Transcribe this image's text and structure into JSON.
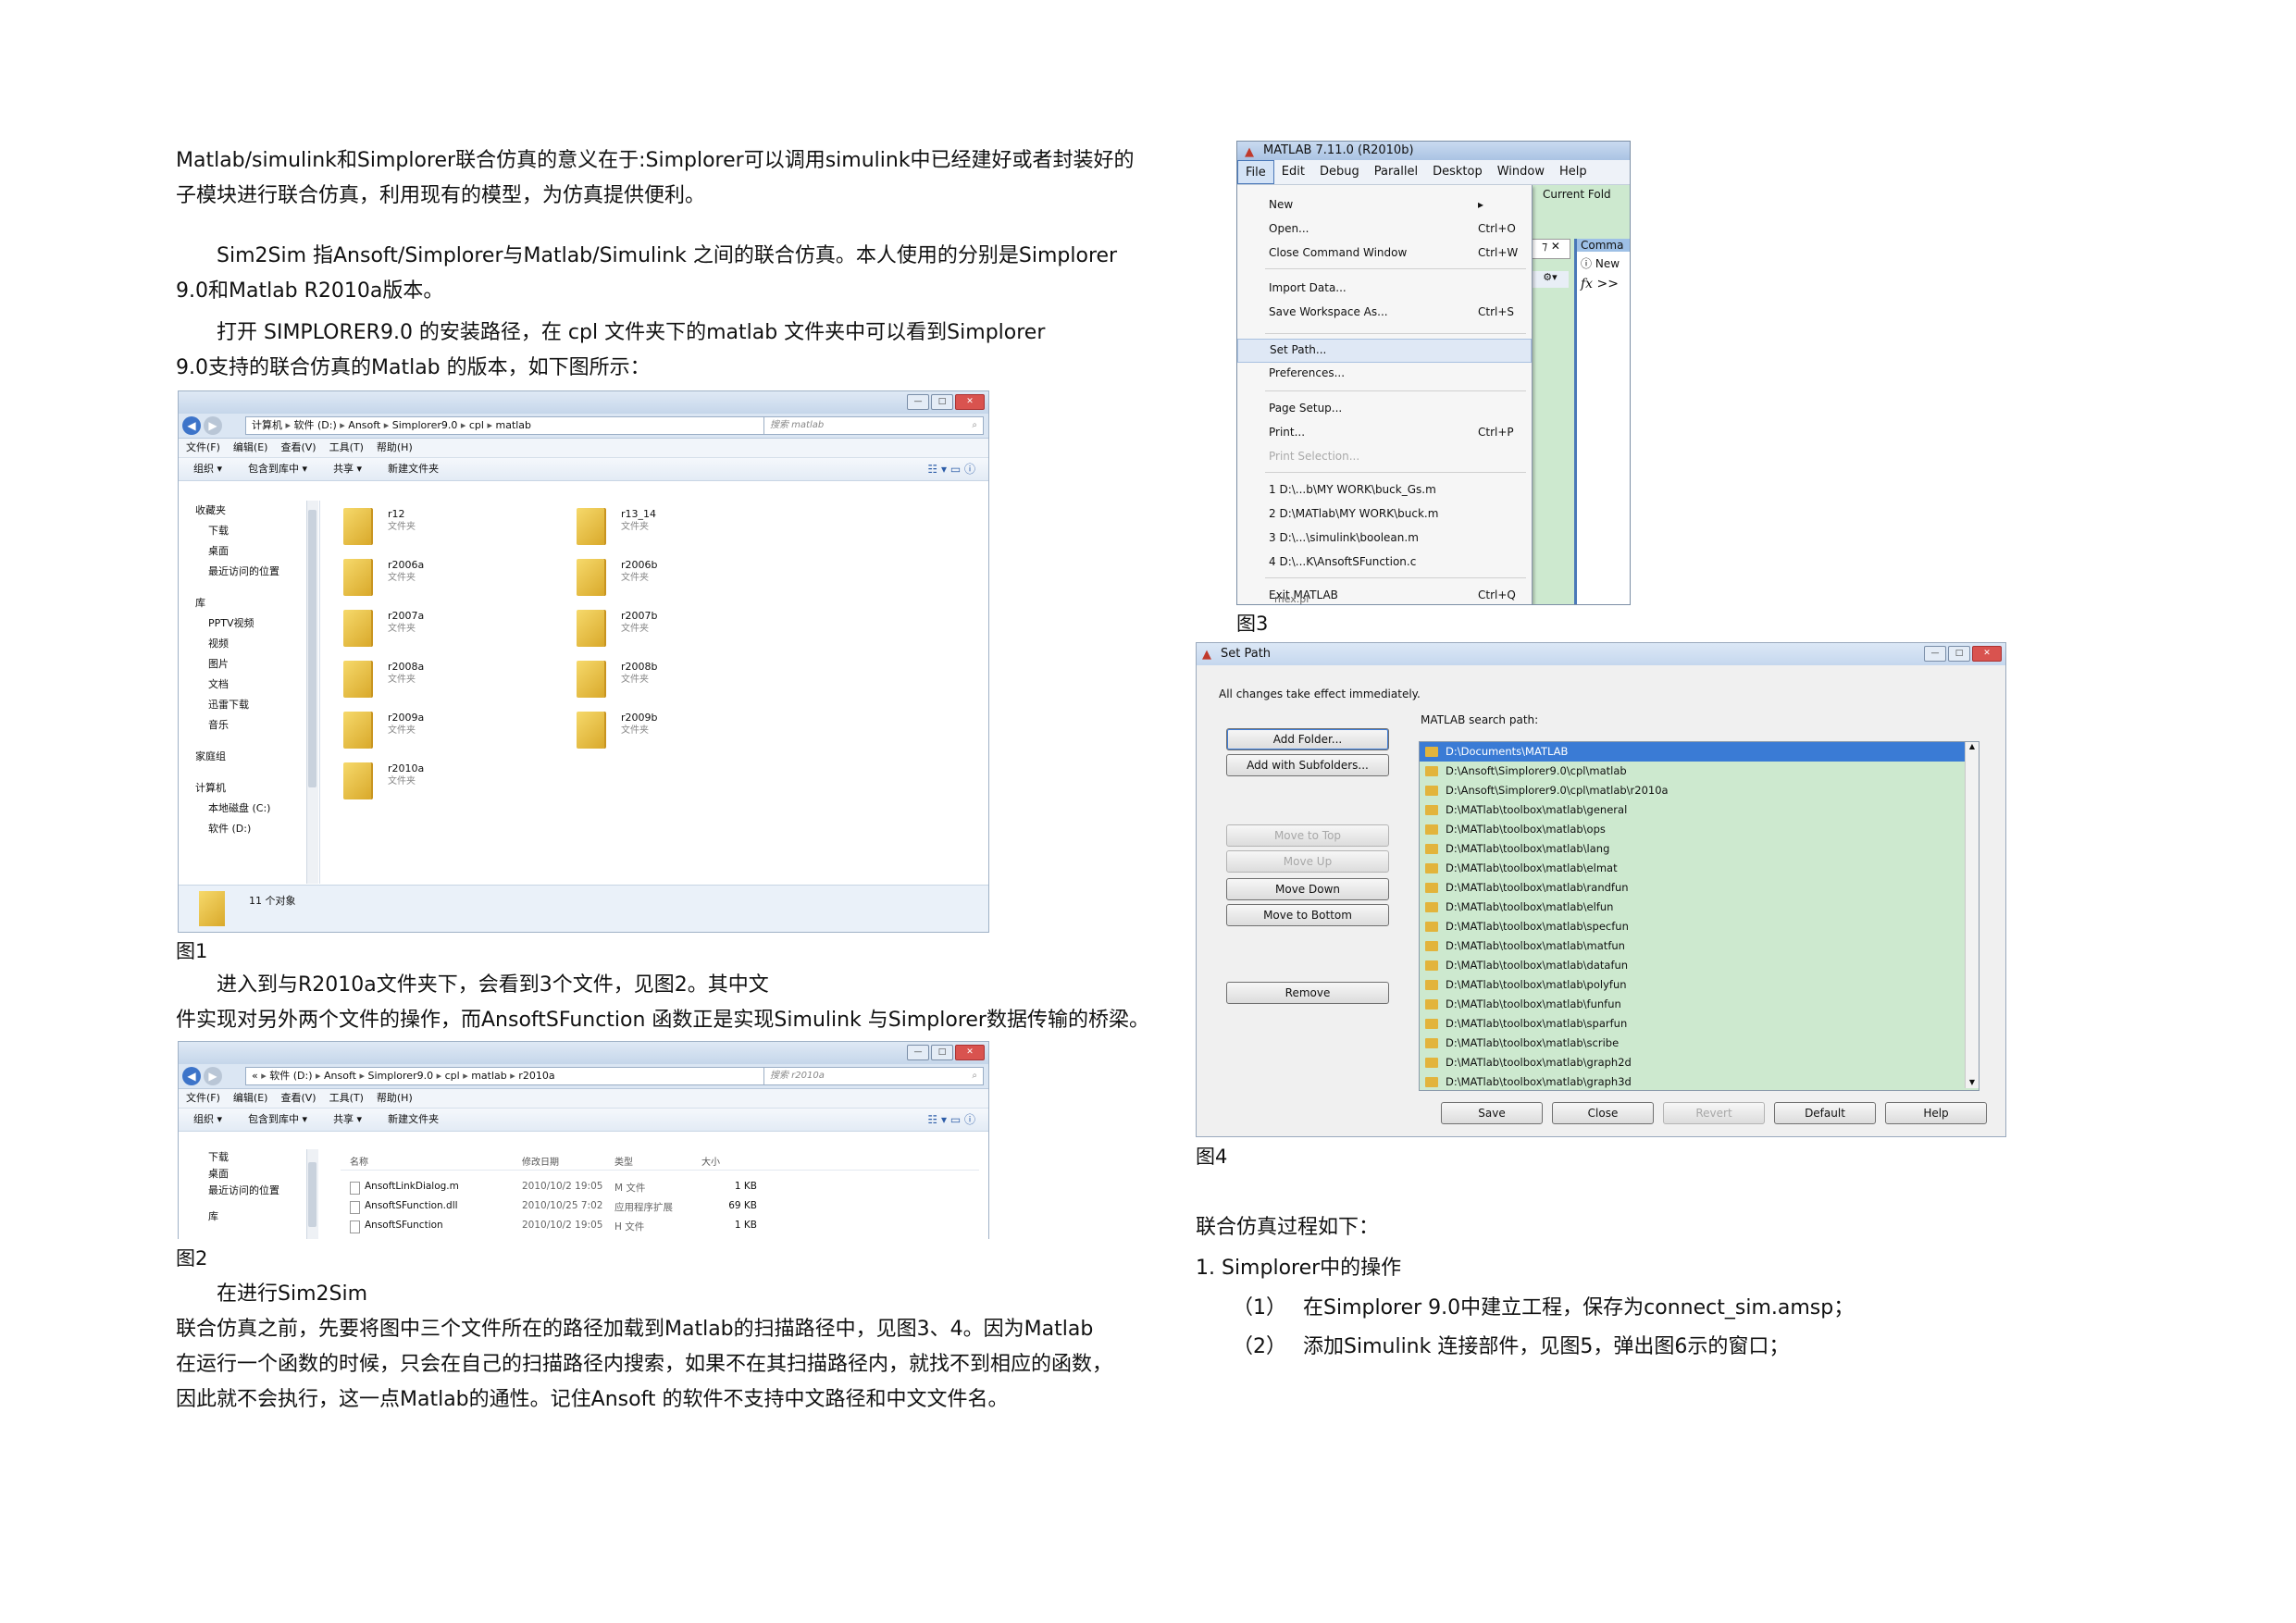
{
  "left_text": {
    "p1_line1": "Matlab/simulink和Simplorer联合仿真的意义在于:Simplorer可以调用simulink中已经建好或者封装好的",
    "p1_line2": "子模块进行联合仿真，利用现有的模型，为仿真提供便利。",
    "p2_line1": "Sim2Sim 指Ansoft/Simplorer与Matlab/Simulink 之间的联合仿真。本人使用的分别是Simplorer",
    "p2_line2": "9.0和Matlab R2010a版本。",
    "p3_line1": "打开 SIMPLORER9.0 的安装路径，在 cpl 文件夹下的matlab 文件夹中可以看到Simplorer",
    "p3_line2": "9.0支持的联合仿真的Matlab 的版本，如下图所示：",
    "fig1_caption": "图1",
    "p4_line1": "进入到与R2010a文件夹下，会看到3个文件，见图2。其中文",
    "p4_line2": "件实现对另外两个文件的操作，而AnsoftSFunction 函数正是实现Simulink 与Simplorer数据传输的桥梁。",
    "fig2_caption": "图2",
    "p5_line1": "在进行Sim2Sim",
    "p5_line2": "联合仿真之前，先要将图中三个文件所在的路径加载到Matlab的扫描路径中，见图3、4。因为Matlab",
    "p5_line3": "在运行一个函数的时候，只会在自己的扫描路径内搜索，如果不在其扫描路径内，就找不到相应的函数，",
    "p5_line4": "因此就不会执行，这一点Matlab的通性。记住Ansoft 的软件不支持中文路径和中文文件名。"
  },
  "fig1": {
    "address": [
      "计算机",
      "软件 (D:)",
      "Ansoft",
      "Simplorer9.0",
      "cpl",
      "matlab"
    ],
    "search_placeholder": "搜索 matlab",
    "menu": [
      "文件(F)",
      "编辑(E)",
      "查看(V)",
      "工具(T)",
      "帮助(H)"
    ],
    "toolbar": [
      "组织 ▾",
      "包含到库中 ▾",
      "共享 ▾",
      "新建文件夹"
    ],
    "nav": [
      "收藏夹",
      "下载",
      "桌面",
      "最近访问的位置",
      "",
      "库",
      "PPTV视频",
      "视频",
      "图片",
      "文档",
      "迅雷下载",
      "音乐",
      "",
      "家庭组",
      "",
      "计算机",
      "本地磁盘 (C:)",
      "软件 (D:)"
    ],
    "folders_col1": [
      "r12",
      "r2006a",
      "r2007a",
      "r2008a",
      "r2009a",
      "r2010a"
    ],
    "folders_col2": [
      "r13_14",
      "r2006b",
      "r2007b",
      "r2008b",
      "r2009b"
    ],
    "folder_type": "文件夹",
    "status": "11 个对象"
  },
  "fig2": {
    "address": [
      "«",
      "软件 (D:)",
      "Ansoft",
      "Simplorer9.0",
      "cpl",
      "matlab",
      "r2010a"
    ],
    "search_placeholder": "搜索 r2010a",
    "menu": [
      "文件(F)",
      "编辑(E)",
      "查看(V)",
      "工具(T)",
      "帮助(H)"
    ],
    "toolbar": [
      "组织 ▾",
      "包含到库中 ▾",
      "共享 ▾",
      "新建文件夹"
    ],
    "nav": [
      "下载",
      "桌面",
      "最近访问的位置",
      "",
      "库"
    ],
    "columns": [
      "名称",
      "修改日期",
      "类型",
      "大小"
    ],
    "files": [
      [
        "AnsoftLinkDialog.m",
        "2010/10/2 19:05",
        "M 文件",
        "1 KB"
      ],
      [
        "AnsoftSFunction.dll",
        "2010/10/25 7:02",
        "应用程序扩展",
        "69 KB"
      ],
      [
        "AnsoftSFunction",
        "2010/10/2 19:05",
        "H 文件",
        "1 KB"
      ]
    ]
  },
  "fig3": {
    "title": "MATLAB  7.11.0 (R2010b)",
    "menubar": [
      "File",
      "Edit",
      "Debug",
      "Parallel",
      "Desktop",
      "Window",
      "Help"
    ],
    "items": [
      {
        "label": "New",
        "shortcut": "▸"
      },
      {
        "label": "Open...",
        "shortcut": "Ctrl+O"
      },
      {
        "label": "Close Command Window",
        "shortcut": "Ctrl+W"
      },
      {
        "label": "Import Data...",
        "shortcut": ""
      },
      {
        "label": "Save Workspace As...",
        "shortcut": "Ctrl+S"
      },
      {
        "label": "Set Path...",
        "shortcut": ""
      },
      {
        "label": "Preferences...",
        "shortcut": ""
      },
      {
        "label": "Page Setup...",
        "shortcut": ""
      },
      {
        "label": "Print...",
        "shortcut": "Ctrl+P"
      },
      {
        "label": "Print Selection...",
        "shortcut": ""
      },
      {
        "label": "1 D:\\...b\\MY WORK\\buck_Gs.m",
        "shortcut": ""
      },
      {
        "label": "2 D:\\MATlab\\MY WORK\\buck.m",
        "shortcut": ""
      },
      {
        "label": "3 D:\\...\\simulink\\boolean.m",
        "shortcut": ""
      },
      {
        "label": "4 D:\\...K\\AnsoftSFunction.c",
        "shortcut": ""
      },
      {
        "label": "Exit MATLAB",
        "shortcut": "Ctrl+Q"
      }
    ],
    "side_current_folder": "Current Fold",
    "side_command": "Comma",
    "side_new": "New",
    "side_prompt": ">>",
    "bottom_cut": "mex.pl",
    "caption": "图3"
  },
  "fig4": {
    "title": "Set Path",
    "note": "All changes take effect immediately.",
    "search_path_label": "MATLAB search path:",
    "buttons_left": [
      "Add Folder...",
      "Add with Subfolders...",
      "Move to Top",
      "Move Up",
      "Move Down",
      "Move to Bottom",
      "Remove"
    ],
    "buttons_bottom": [
      "Save",
      "Close",
      "Revert",
      "Default",
      "Help"
    ],
    "paths": [
      "D:\\Documents\\MATLAB",
      "D:\\Ansoft\\Simplorer9.0\\cpl\\matlab",
      "D:\\Ansoft\\Simplorer9.0\\cpl\\matlab\\r2010a",
      "D:\\MATlab\\toolbox\\matlab\\general",
      "D:\\MATlab\\toolbox\\matlab\\ops",
      "D:\\MATlab\\toolbox\\matlab\\lang",
      "D:\\MATlab\\toolbox\\matlab\\elmat",
      "D:\\MATlab\\toolbox\\matlab\\randfun",
      "D:\\MATlab\\toolbox\\matlab\\elfun",
      "D:\\MATlab\\toolbox\\matlab\\specfun",
      "D:\\MATlab\\toolbox\\matlab\\matfun",
      "D:\\MATlab\\toolbox\\matlab\\datafun",
      "D:\\MATlab\\toolbox\\matlab\\polyfun",
      "D:\\MATlab\\toolbox\\matlab\\funfun",
      "D:\\MATlab\\toolbox\\matlab\\sparfun",
      "D:\\MATlab\\toolbox\\matlab\\scribe",
      "D:\\MATlab\\toolbox\\matlab\\graph2d",
      "D:\\MATlab\\toolbox\\matlab\\graph3d"
    ],
    "caption": "图4"
  },
  "right_text": {
    "heading": "联合仿真过程如下：",
    "step1": "1.   Simplorer中的操作",
    "sub1_num": "（1）",
    "sub1": "在Simplorer 9.0中建立工程，保存为connect_sim.amsp；",
    "sub2_num": "（2）",
    "sub2": "添加Simulink 连接部件，见图5，弹出图6示的窗口；"
  }
}
